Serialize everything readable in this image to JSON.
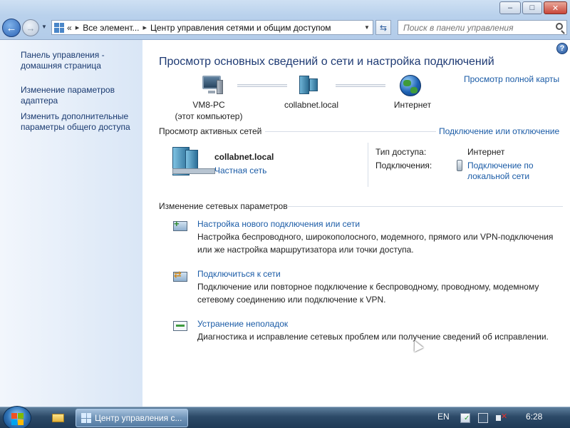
{
  "window": {
    "minimize_glyph": "–",
    "maximize_glyph": "□",
    "close_glyph": "✕"
  },
  "address_bar": {
    "overflow": "«",
    "crumbs": [
      "Все элемент...",
      "Центр управления сетями и общим доступом"
    ],
    "separator": "▸"
  },
  "search": {
    "placeholder": "Поиск в панели управления"
  },
  "left_pane": {
    "items": [
      "Панель управления - домашняя страница",
      "Изменение параметров адаптера",
      "Изменить дополнительные параметры общего доступа"
    ]
  },
  "main": {
    "title": "Просмотр основных сведений о сети и настройка подключений",
    "full_map_link": "Просмотр полной карты",
    "map": {
      "computer_name": "VM8-PC",
      "computer_note": "(этот компьютер)",
      "network_name": "collabnet.local",
      "internet": "Интернет"
    },
    "active_networks": {
      "heading": "Просмотр активных сетей",
      "connect_link": "Подключение или отключение",
      "network_name": "collabnet.local",
      "network_type": "Частная сеть",
      "access_type_label": "Тип доступа:",
      "access_type_value": "Интернет",
      "connections_label": "Подключения:",
      "connections_value": "Подключение по локальной сети"
    },
    "change_settings": {
      "heading": "Изменение сетевых параметров",
      "tasks": [
        {
          "title": "Настройка нового подключения или сети",
          "description": "Настройка беспроводного, широкополосного, модемного, прямого или VPN-подключения или же настройка маршрутизатора или точки доступа."
        },
        {
          "title": "Подключиться к сети",
          "description": "Подключение или повторное подключение к беспроводному, проводному, модемному сетевому соединению или подключение к VPN."
        },
        {
          "title": "Устранение неполадок",
          "description": "Диагностика и исправление сетевых проблем или получение сведений об исправлении."
        }
      ]
    },
    "help_glyph": "?"
  },
  "taskbar": {
    "active_window": "Центр управления с...",
    "language": "EN",
    "clock": "6:28"
  },
  "colors": {
    "link": "#1a5ba6",
    "title": "#1e3a73",
    "left_pane": "#dce8f6",
    "taskbar": "#2c4a68"
  }
}
